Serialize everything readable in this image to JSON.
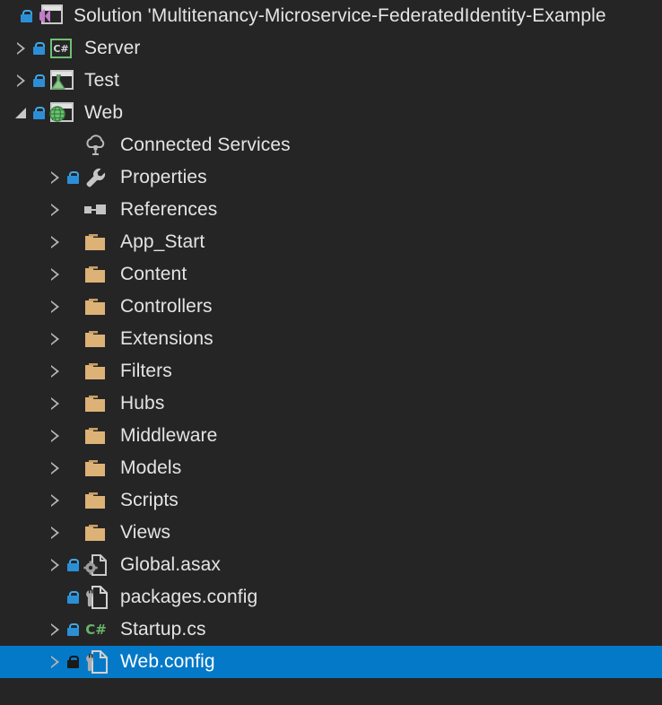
{
  "theme": {
    "background": "#252526",
    "text": "#E4E4E4",
    "selection": "#0479C8",
    "selection_text": "#FFFFFF",
    "folder_icon": "#DDB277",
    "lock_badge": "#2C8FD6",
    "csharp_green": "#68B469",
    "vs_purple": "#C07CC8",
    "document_gray": "#C8C8C8"
  },
  "tree": [
    {
      "label": "Solution 'Multitenancy-Microservice-FederatedIdentity-Example",
      "icon": "visual-studio-solution-icon",
      "name": "solution-node",
      "level": 0,
      "expander": "none",
      "lock": true,
      "selected": false
    },
    {
      "label": "Server",
      "icon": "csharp-project-icon",
      "name": "project-server",
      "level": 1,
      "expander": "collapsed",
      "lock": true,
      "selected": false
    },
    {
      "label": "Test",
      "icon": "test-project-icon",
      "name": "project-test",
      "level": 1,
      "expander": "collapsed",
      "lock": true,
      "selected": false
    },
    {
      "label": "Web",
      "icon": "web-project-icon",
      "name": "project-web",
      "level": 1,
      "expander": "expanded",
      "lock": true,
      "selected": false
    },
    {
      "label": "Connected Services",
      "icon": "cloud-connected-services-icon",
      "name": "connected-services",
      "level": 2,
      "expander": "none",
      "lock": false,
      "selected": false
    },
    {
      "label": "Properties",
      "icon": "wrench-properties-icon",
      "name": "properties-node",
      "level": 2,
      "expander": "collapsed",
      "lock": true,
      "selected": false
    },
    {
      "label": "References",
      "icon": "references-icon",
      "name": "references-node",
      "level": 2,
      "expander": "collapsed",
      "lock": false,
      "selected": false
    },
    {
      "label": "App_Start",
      "icon": "folder-icon",
      "name": "folder-app-start",
      "level": 2,
      "expander": "collapsed",
      "lock": false,
      "selected": false
    },
    {
      "label": "Content",
      "icon": "folder-icon",
      "name": "folder-content",
      "level": 2,
      "expander": "collapsed",
      "lock": false,
      "selected": false
    },
    {
      "label": "Controllers",
      "icon": "folder-icon",
      "name": "folder-controllers",
      "level": 2,
      "expander": "collapsed",
      "lock": false,
      "selected": false
    },
    {
      "label": "Extensions",
      "icon": "folder-icon",
      "name": "folder-extensions",
      "level": 2,
      "expander": "collapsed",
      "lock": false,
      "selected": false
    },
    {
      "label": "Filters",
      "icon": "folder-icon",
      "name": "folder-filters",
      "level": 2,
      "expander": "collapsed",
      "lock": false,
      "selected": false
    },
    {
      "label": "Hubs",
      "icon": "folder-icon",
      "name": "folder-hubs",
      "level": 2,
      "expander": "collapsed",
      "lock": false,
      "selected": false
    },
    {
      "label": "Middleware",
      "icon": "folder-icon",
      "name": "folder-middleware",
      "level": 2,
      "expander": "collapsed",
      "lock": false,
      "selected": false
    },
    {
      "label": "Models",
      "icon": "folder-icon",
      "name": "folder-models",
      "level": 2,
      "expander": "collapsed",
      "lock": false,
      "selected": false
    },
    {
      "label": "Scripts",
      "icon": "folder-icon",
      "name": "folder-scripts",
      "level": 2,
      "expander": "collapsed",
      "lock": false,
      "selected": false
    },
    {
      "label": "Views",
      "icon": "folder-icon",
      "name": "folder-views",
      "level": 2,
      "expander": "collapsed",
      "lock": false,
      "selected": false
    },
    {
      "label": "Global.asax",
      "icon": "gear-document-icon",
      "name": "file-global-asax",
      "level": 2,
      "expander": "collapsed",
      "lock": true,
      "selected": false
    },
    {
      "label": "packages.config",
      "icon": "config-document-icon",
      "name": "file-packages-config",
      "level": 2,
      "expander": "none",
      "lock": true,
      "selected": false
    },
    {
      "label": "Startup.cs",
      "icon": "csharp-file-icon",
      "name": "file-startup-cs",
      "level": 2,
      "expander": "collapsed",
      "lock": true,
      "selected": false
    },
    {
      "label": "Web.config",
      "icon": "config-document-icon",
      "name": "file-web-config",
      "level": 2,
      "expander": "collapsed",
      "lock": true,
      "selected": true
    }
  ]
}
